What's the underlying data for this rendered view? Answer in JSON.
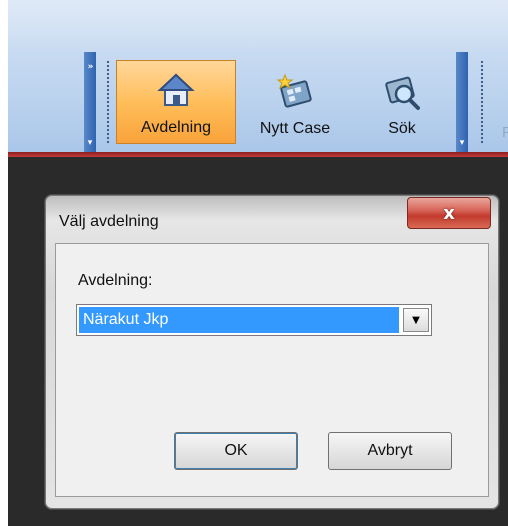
{
  "toolbar": {
    "buttons": [
      {
        "label": "Avdelning",
        "icon": "house-icon",
        "active": true
      },
      {
        "label": "Nytt Case",
        "icon": "new-case-icon",
        "active": false
      },
      {
        "label": "Sök",
        "icon": "search-icon",
        "active": false
      }
    ],
    "overflow_glyph": "»",
    "dropdown_glyph": "▾",
    "cut_label": "F"
  },
  "dialog": {
    "title": "Välj avdelning",
    "close_glyph": "x",
    "field_label": "Avdelning:",
    "combo": {
      "selected": "Närakut Jkp",
      "arrow_glyph": "▼"
    },
    "ok_label": "OK",
    "cancel_label": "Avbryt"
  },
  "colors": {
    "toolbar_bg": "#bcd3ee",
    "active_button": "#ffbe5b",
    "selection": "#3399ff",
    "close_button": "#c23a2d",
    "app_bg": "#2a2a2a"
  }
}
